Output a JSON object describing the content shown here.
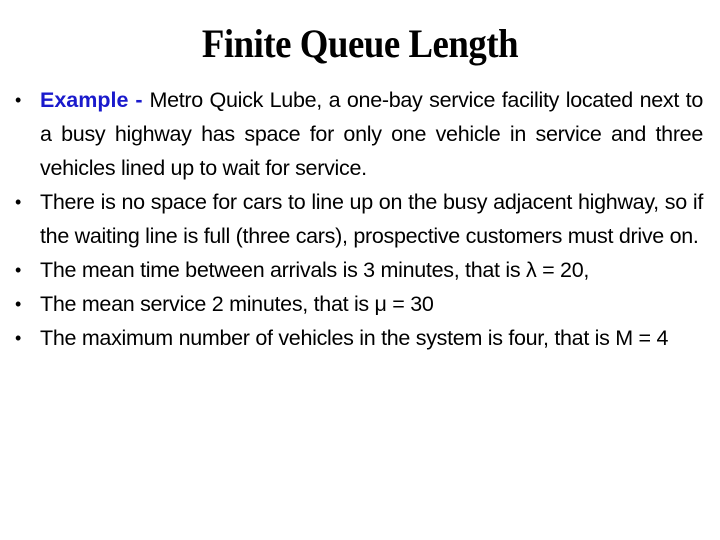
{
  "slide": {
    "title": "Finite Queue Length",
    "bullets": [
      {
        "label": "Example - ",
        "text": "Metro Quick Lube, a one-bay service facility located next to a busy highway has space for only one vehicle in service and three vehicles lined up to wait for service."
      },
      {
        "label": "",
        "text": "There is no space for cars to line up on the busy adjacent highway, so if the waiting line is full (three cars), prospective customers must drive on."
      },
      {
        "label": "",
        "text": "The mean time between arrivals is 3 minutes, that is λ = 20,"
      },
      {
        "label": "",
        "text": "The mean service 2 minutes, that is μ = 30"
      },
      {
        "label": "",
        "text": "The maximum number of vehicles in the system is four, that is M = 4"
      }
    ],
    "bullet_glyph": "•",
    "label_color": "#1a1acc"
  }
}
